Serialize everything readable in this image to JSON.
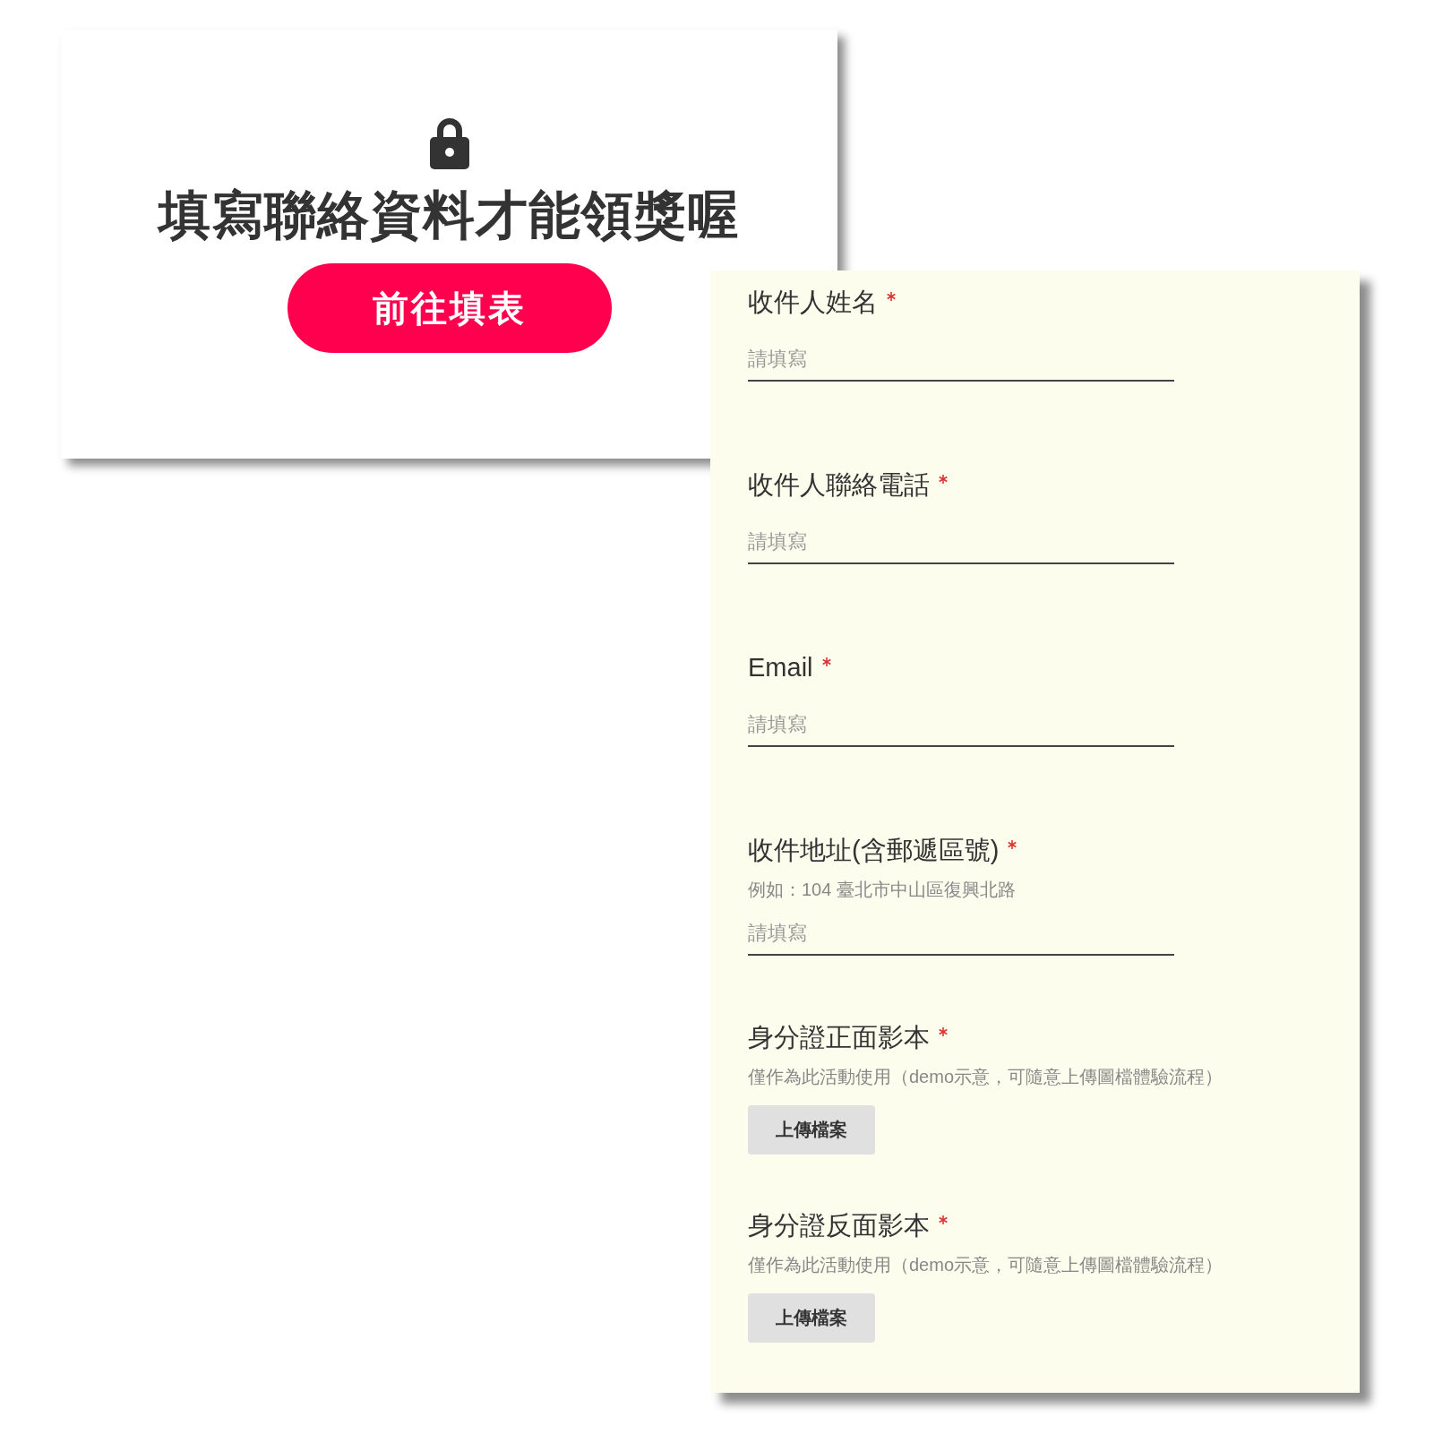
{
  "prompt_card": {
    "message": "填寫聯絡資料才能領獎喔",
    "button": "前往填表"
  },
  "form": {
    "fields": [
      {
        "kind": "text",
        "label": "收件人姓名",
        "required": true,
        "placeholder": "請填寫"
      },
      {
        "kind": "text",
        "label": "收件人聯絡電話",
        "required": true,
        "placeholder": "請填寫"
      },
      {
        "kind": "text",
        "label": "Email",
        "required": true,
        "placeholder": "請填寫"
      },
      {
        "kind": "text",
        "label": "收件地址(含郵遞區號)",
        "required": true,
        "hint": "例如：104 臺北市中山區復興北路",
        "placeholder": "請填寫"
      },
      {
        "kind": "upload",
        "label": "身分證正面影本",
        "required": true,
        "hint": "僅作為此活動使用（demo示意，可隨意上傳圖檔體驗流程）",
        "button": "上傳檔案"
      },
      {
        "kind": "upload",
        "label": "身分證反面影本",
        "required": true,
        "hint": "僅作為此活動使用（demo示意，可隨意上傳圖檔體驗流程）",
        "button": "上傳檔案"
      }
    ]
  }
}
